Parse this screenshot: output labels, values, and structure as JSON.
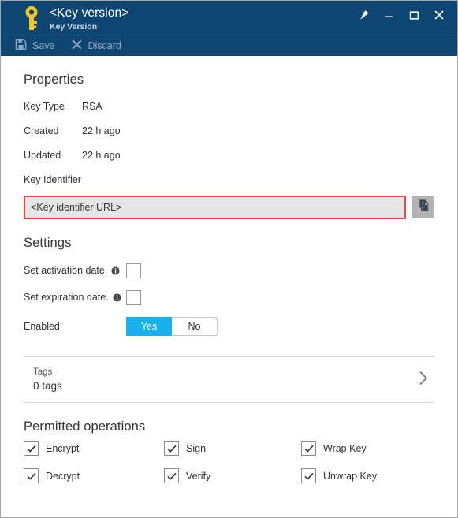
{
  "window": {
    "title": "<Key version>",
    "subtitle": "Key Version",
    "icon": "key-icon",
    "header_color": "#0E4673"
  },
  "titlebar_buttons": [
    {
      "name": "pin-icon",
      "label": "Pin"
    },
    {
      "name": "minimize-icon",
      "label": "Minimize"
    },
    {
      "name": "maximize-icon",
      "label": "Maximize"
    },
    {
      "name": "close-icon",
      "label": "Close"
    }
  ],
  "toolbar": {
    "save_label": "Save",
    "save_icon": "save-icon",
    "discard_label": "Discard",
    "discard_icon": "discard-icon"
  },
  "properties": {
    "heading": "Properties",
    "rows": [
      {
        "label": "Key Type",
        "value": "RSA"
      },
      {
        "label": "Created",
        "value": "22 h ago"
      },
      {
        "label": "Updated",
        "value": "22 h ago"
      },
      {
        "label": "Key Identifier",
        "value": ""
      }
    ],
    "key_identifier": {
      "value": "<Key identifier URL>",
      "placeholder": "<Key identifier URL>",
      "highlight_color": "#E8473F",
      "field_background": "#E6E6E6",
      "copy_icon": "copy-icon"
    }
  },
  "settings": {
    "heading": "Settings",
    "activation": {
      "label": "Set activation date.",
      "info_icon": "info-icon",
      "checked": false
    },
    "expiration": {
      "label": "Set expiration date.",
      "info_icon": "info-icon",
      "checked": false
    },
    "enabled": {
      "label": "Enabled",
      "yes_label": "Yes",
      "no_label": "No",
      "selected": "Yes",
      "accent_color": "#18B0EC"
    }
  },
  "tags": {
    "title": "Tags",
    "count_label": "0 tags",
    "chevron_icon": "chevron-right-icon"
  },
  "permitted_operations": {
    "heading": "Permitted operations",
    "items": [
      {
        "label": "Encrypt",
        "checked": true
      },
      {
        "label": "Sign",
        "checked": true
      },
      {
        "label": "Wrap Key",
        "checked": true
      },
      {
        "label": "Decrypt",
        "checked": true
      },
      {
        "label": "Verify",
        "checked": true
      },
      {
        "label": "Unwrap Key",
        "checked": true
      }
    ]
  }
}
